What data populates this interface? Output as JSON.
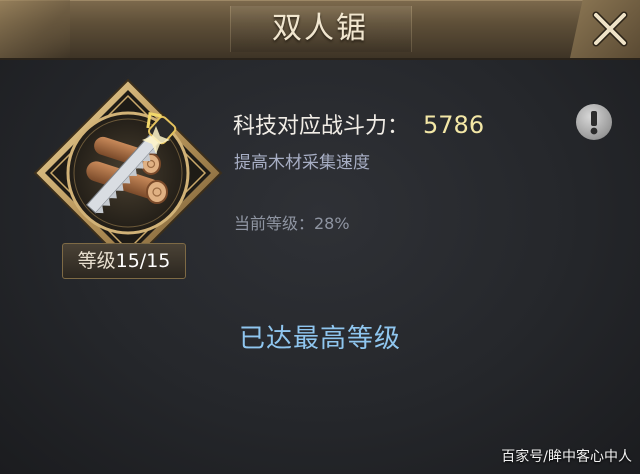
{
  "header": {
    "title": "双人锯"
  },
  "tech": {
    "power_label": "科技对应战斗力：",
    "power_value": "5786",
    "description": "提高木材采集速度",
    "current_level_text": "当前等级：28%"
  },
  "badge": {
    "icon": "saw-and-logs-icon",
    "level_prefix": "等级",
    "level_value": "15/15"
  },
  "status": {
    "max_level_text": "已达最高等级"
  },
  "watermark": {
    "text": "百家号/眸中客心中人"
  },
  "colors": {
    "power_value": "#f3e7a6",
    "max_level": "#8fc6ef",
    "gold_frame": "#c9a86a"
  }
}
